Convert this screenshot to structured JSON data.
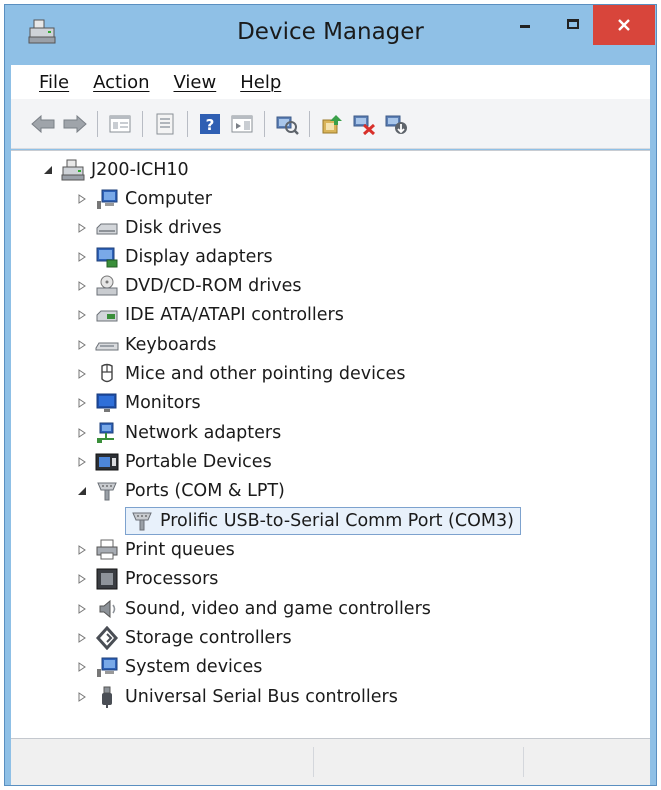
{
  "window": {
    "title": "Device Manager",
    "colors": {
      "frame": "#8fc0e6",
      "close": "#d8453b",
      "selection": "#e8f1fb"
    }
  },
  "menu": {
    "items": [
      {
        "label": "File"
      },
      {
        "label": "Action"
      },
      {
        "label": "View"
      },
      {
        "label": "Help"
      }
    ]
  },
  "toolbar": {
    "buttons": [
      {
        "icon": "back-arrow-icon"
      },
      {
        "icon": "forward-arrow-icon"
      },
      {
        "icon": "show-hide-console-tree-icon"
      },
      {
        "icon": "properties-icon"
      },
      {
        "icon": "help-icon"
      },
      {
        "icon": "show-action-pane-icon"
      },
      {
        "icon": "scan-hardware-changes-icon"
      },
      {
        "icon": "update-driver-icon"
      },
      {
        "icon": "uninstall-device-icon"
      },
      {
        "icon": "enable-device-icon"
      }
    ]
  },
  "tree": {
    "root": {
      "label": "J200-ICH10",
      "icon": "computer-root-icon",
      "expanded": true
    },
    "categories": [
      {
        "label": "Computer",
        "icon": "computer-icon"
      },
      {
        "label": "Disk drives",
        "icon": "disk-drive-icon"
      },
      {
        "label": "Display adapters",
        "icon": "display-adapter-icon"
      },
      {
        "label": "DVD/CD-ROM drives",
        "icon": "dvd-drive-icon"
      },
      {
        "label": "IDE ATA/ATAPI controllers",
        "icon": "ide-controller-icon"
      },
      {
        "label": "Keyboards",
        "icon": "keyboard-icon"
      },
      {
        "label": "Mice and other pointing devices",
        "icon": "mouse-icon"
      },
      {
        "label": "Monitors",
        "icon": "monitor-icon"
      },
      {
        "label": "Network adapters",
        "icon": "network-adapter-icon"
      },
      {
        "label": "Portable Devices",
        "icon": "portable-device-icon"
      },
      {
        "label": "Ports (COM & LPT)",
        "icon": "port-icon",
        "expanded": true
      },
      {
        "label": "Prolific USB-to-Serial Comm Port (COM3)",
        "icon": "port-icon",
        "child": true,
        "selected": true
      },
      {
        "label": "Print queues",
        "icon": "printer-icon"
      },
      {
        "label": "Processors",
        "icon": "processor-icon"
      },
      {
        "label": "Sound, video and game controllers",
        "icon": "speaker-icon"
      },
      {
        "label": "Storage controllers",
        "icon": "storage-controller-icon"
      },
      {
        "label": "System devices",
        "icon": "system-device-icon"
      },
      {
        "label": "Universal Serial Bus controllers",
        "icon": "usb-icon"
      }
    ]
  }
}
